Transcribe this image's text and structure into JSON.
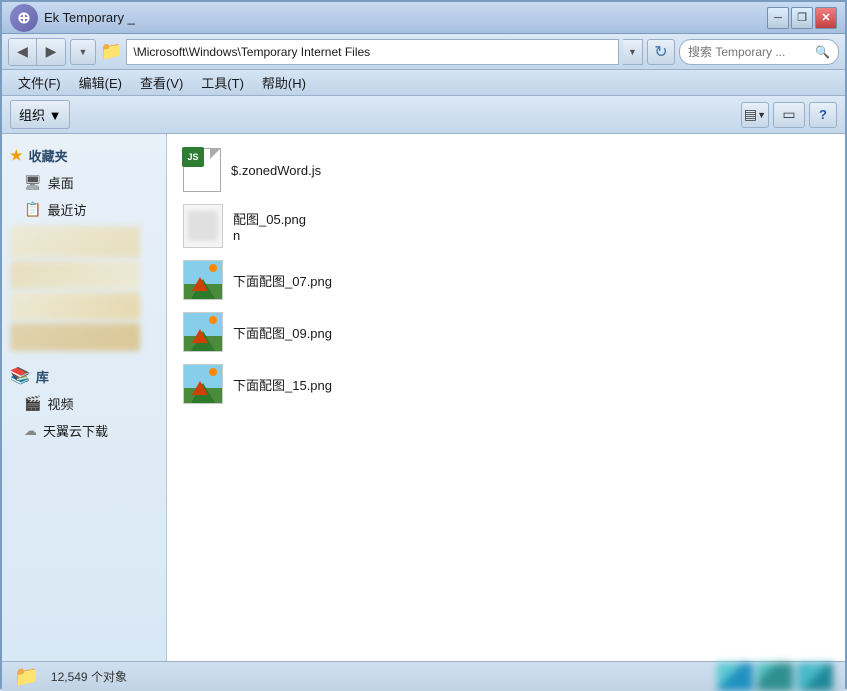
{
  "titlebar": {
    "title": "Ek Temporary _",
    "minimize_label": "─",
    "restore_label": "❐",
    "close_label": "✕"
  },
  "addressbar": {
    "back_label": "◀",
    "forward_label": "▶",
    "dropdown_label": "▼",
    "refresh_label": "↻",
    "path": "\\Microsoft\\Windows\\Temporary Internet Files",
    "search_placeholder": "搜索 Temporary ... ",
    "search_icon": "🔍"
  },
  "menubar": {
    "items": [
      {
        "label": "文件(F)"
      },
      {
        "label": "编辑(E)"
      },
      {
        "label": "查看(V)"
      },
      {
        "label": "工具(T)"
      },
      {
        "label": "帮助(H)"
      }
    ]
  },
  "toolbar": {
    "organize_label": "组织 ▼",
    "view_label": "▤",
    "pane_label": "▭",
    "help_label": "?"
  },
  "sidebar": {
    "favorites_label": "收藏夹",
    "desktop_label": "桌面",
    "recent_label": "最近访",
    "library_label": "库",
    "video_label": "视频",
    "download_label": "天翼云下载"
  },
  "files": [
    {
      "name": "$.zonedWord.js",
      "type": "js"
    },
    {
      "name": "配图_05.png\nn",
      "type": "unknown"
    },
    {
      "name": "下面配图_07.png",
      "type": "image"
    },
    {
      "name": "下面配图_09.png",
      "type": "image"
    },
    {
      "name": "下面配图_15.png",
      "type": "image"
    }
  ],
  "statusbar": {
    "count_label": "12,549 个对象"
  }
}
